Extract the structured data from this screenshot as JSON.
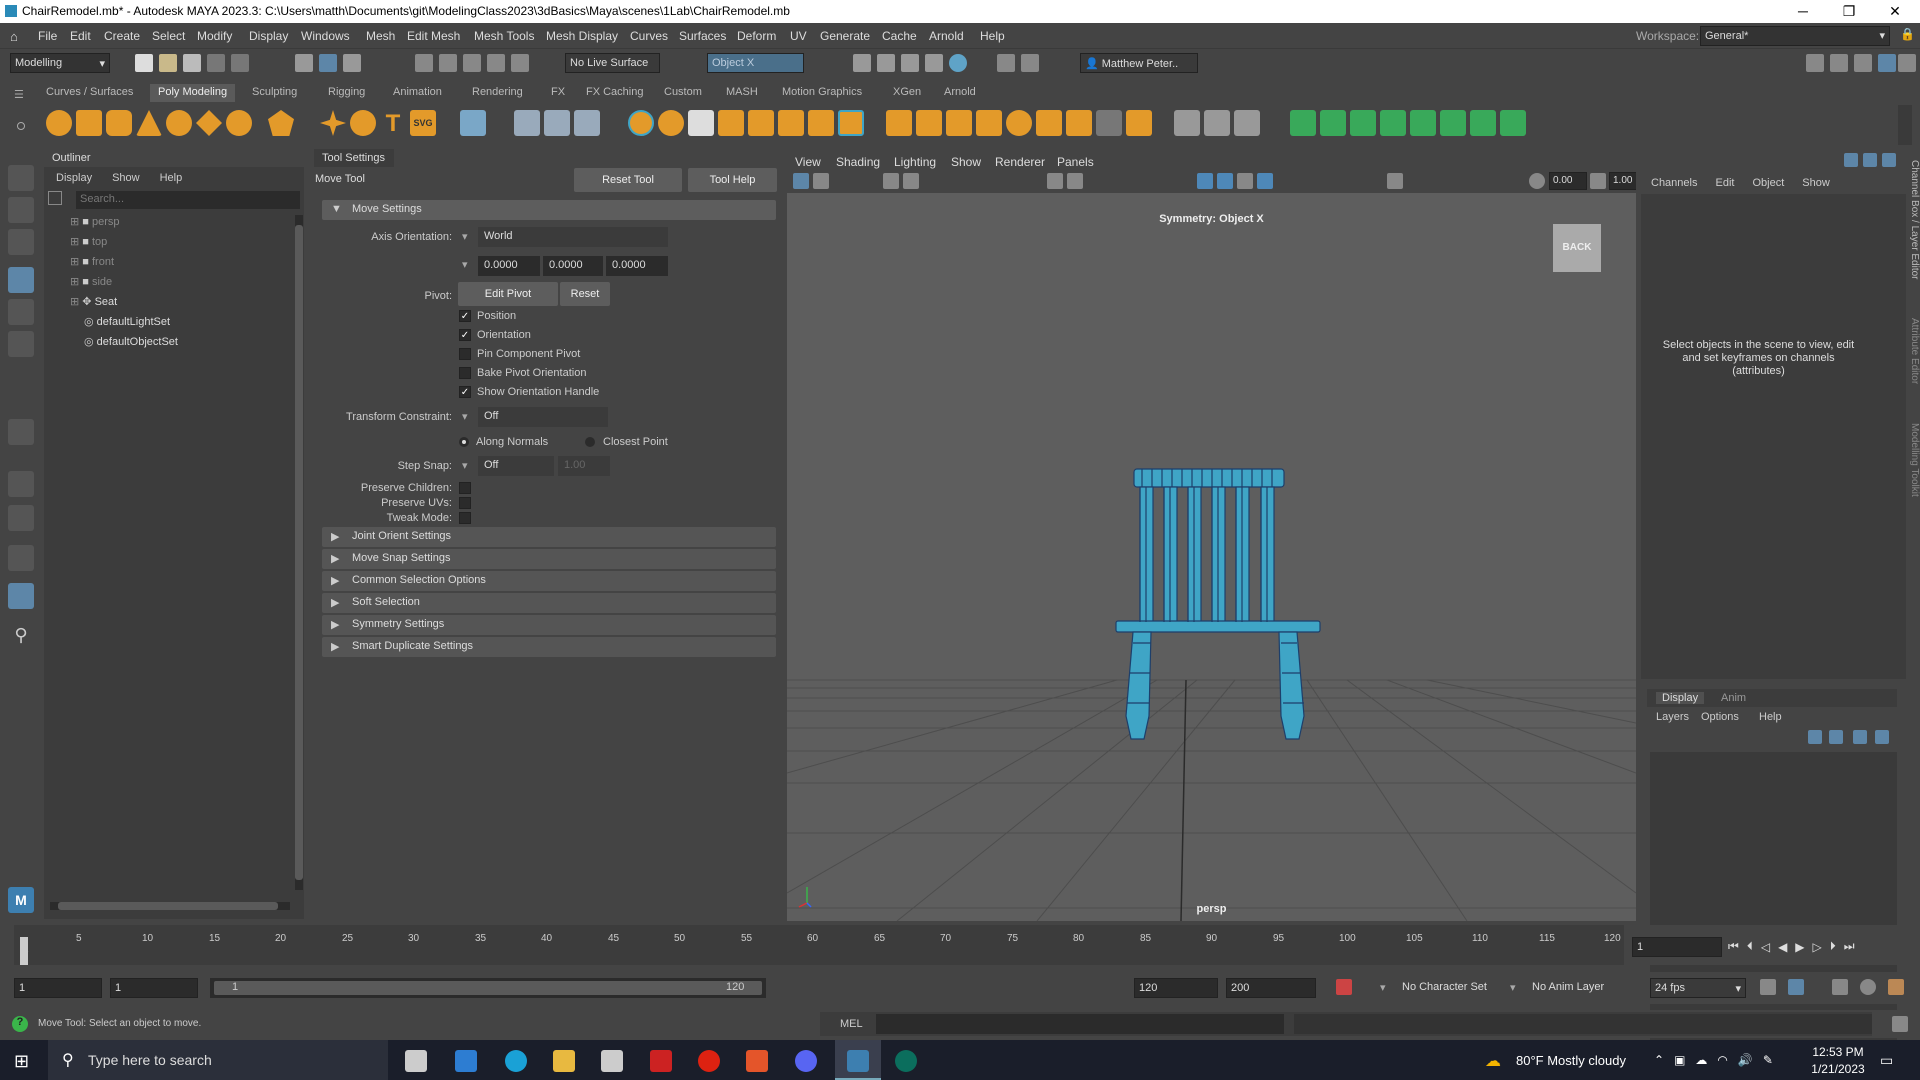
{
  "title_bar": {
    "title": "ChairRemodel.mb* - Autodesk MAYA 2023.3: C:\\Users\\matth\\Documents\\git\\ModelingClass2023\\3dBasics\\Maya\\scenes\\1Lab\\ChairRemodel.mb",
    "minimize": "─",
    "restore": "❐",
    "close": "✕"
  },
  "menu_bar": {
    "items": [
      "File",
      "Edit",
      "Create",
      "Select",
      "Modify",
      "Display",
      "Windows",
      "Mesh",
      "Edit Mesh",
      "Mesh Tools",
      "Mesh Display",
      "Curves",
      "Surfaces",
      "Deform",
      "UV",
      "Generate",
      "Cache",
      "Arnold",
      "Help"
    ],
    "workspace_label": "Workspace:",
    "workspace_value": "General*"
  },
  "status_line": {
    "menu_set": "Modelling",
    "live_surface": "No Live Surface",
    "symmetry": "Object X",
    "user": "Matthew Peter.."
  },
  "shelf": {
    "tabs": [
      "Curves / Surfaces",
      "Poly Modeling",
      "Sculpting",
      "Rigging",
      "Animation",
      "Rendering",
      "FX",
      "FX Caching",
      "Custom",
      "MASH",
      "Motion Graphics",
      "XGen",
      "Arnold"
    ],
    "active_tab": "Poly Modeling",
    "svg_icon_label": "SVG"
  },
  "outliner": {
    "title": "Outliner",
    "menus": [
      "Display",
      "Show",
      "Help"
    ],
    "search_placeholder": "Search...",
    "items": [
      {
        "label": "persp",
        "dim": true
      },
      {
        "label": "top",
        "dim": true
      },
      {
        "label": "front",
        "dim": true
      },
      {
        "label": "side",
        "dim": true
      },
      {
        "label": "Seat",
        "dim": false
      },
      {
        "label": "defaultLightSet",
        "dim": false
      },
      {
        "label": "defaultObjectSet",
        "dim": false
      }
    ]
  },
  "tool_settings": {
    "title": "Tool Settings",
    "tool_name": "Move Tool",
    "reset_tool": "Reset Tool",
    "tool_help": "Tool Help",
    "section_move": "Move Settings",
    "axis_orientation_label": "Axis Orientation:",
    "axis_orientation_value": "World",
    "axis_x": "0.0000",
    "axis_y": "0.0000",
    "axis_z": "0.0000",
    "pivot_label": "Pivot:",
    "edit_pivot": "Edit Pivot",
    "reset": "Reset",
    "position": "Position",
    "orientation": "Orientation",
    "pin_component_pivot": "Pin Component Pivot",
    "bake_pivot_orientation": "Bake Pivot Orientation",
    "show_orientation_handle": "Show Orientation Handle",
    "transform_constraint_label": "Transform Constraint:",
    "transform_constraint_value": "Off",
    "along_normals": "Along Normals",
    "closest_point": "Closest Point",
    "step_snap_label": "Step Snap:",
    "step_snap_value": "Off",
    "step_snap_amount": "1.00",
    "preserve_children": "Preserve Children:",
    "preserve_uvs": "Preserve UVs:",
    "tweak_mode": "Tweak Mode:",
    "sections": [
      "Joint Orient Settings",
      "Move Snap Settings",
      "Common Selection Options",
      "Soft Selection",
      "Symmetry Settings",
      "Smart Duplicate Settings"
    ]
  },
  "viewport": {
    "menus": [
      "View",
      "Shading",
      "Lighting",
      "Show",
      "Renderer",
      "Panels"
    ],
    "symmetry_label": "Symmetry: Object X",
    "view_cube": "BACK",
    "camera": "persp",
    "field_1": "0.00",
    "field_2": "1.00",
    "accent": "#3fa5c6"
  },
  "channel_box": {
    "menus": [
      "Channels",
      "Edit",
      "Object",
      "Show"
    ],
    "hint": "Select objects in the scene to view, edit and set keyframes on channels (attributes)",
    "side_tabs": [
      "Channel Box / Layer Editor",
      "Attribute Editor",
      "Modelling Toolkit"
    ],
    "layer_tabs": [
      "Display",
      "Anim"
    ],
    "layer_menus": [
      "Layers",
      "Options",
      "Help"
    ]
  },
  "timeline": {
    "ticks": [
      "1",
      "5",
      "10",
      "15",
      "20",
      "25",
      "30",
      "35",
      "40",
      "45",
      "50",
      "55",
      "60",
      "65",
      "70",
      "75",
      "80",
      "85",
      "90",
      "95",
      "100",
      "105",
      "110",
      "115",
      "120"
    ],
    "current_frame": "1"
  },
  "range": {
    "start": "1",
    "start2": "1",
    "slider_start": "1",
    "slider_end": "120",
    "end": "120",
    "end2": "200",
    "character_set": "No Character Set",
    "anim_layer": "No Anim Layer",
    "fps": "24 fps"
  },
  "help_line": {
    "text": "Move Tool: Select an object to move.",
    "mel_label": "MEL"
  },
  "taskbar": {
    "search": "Type here to search",
    "weather": "80°F  Mostly cloudy",
    "time": "12:53 PM",
    "date": "1/21/2023"
  }
}
